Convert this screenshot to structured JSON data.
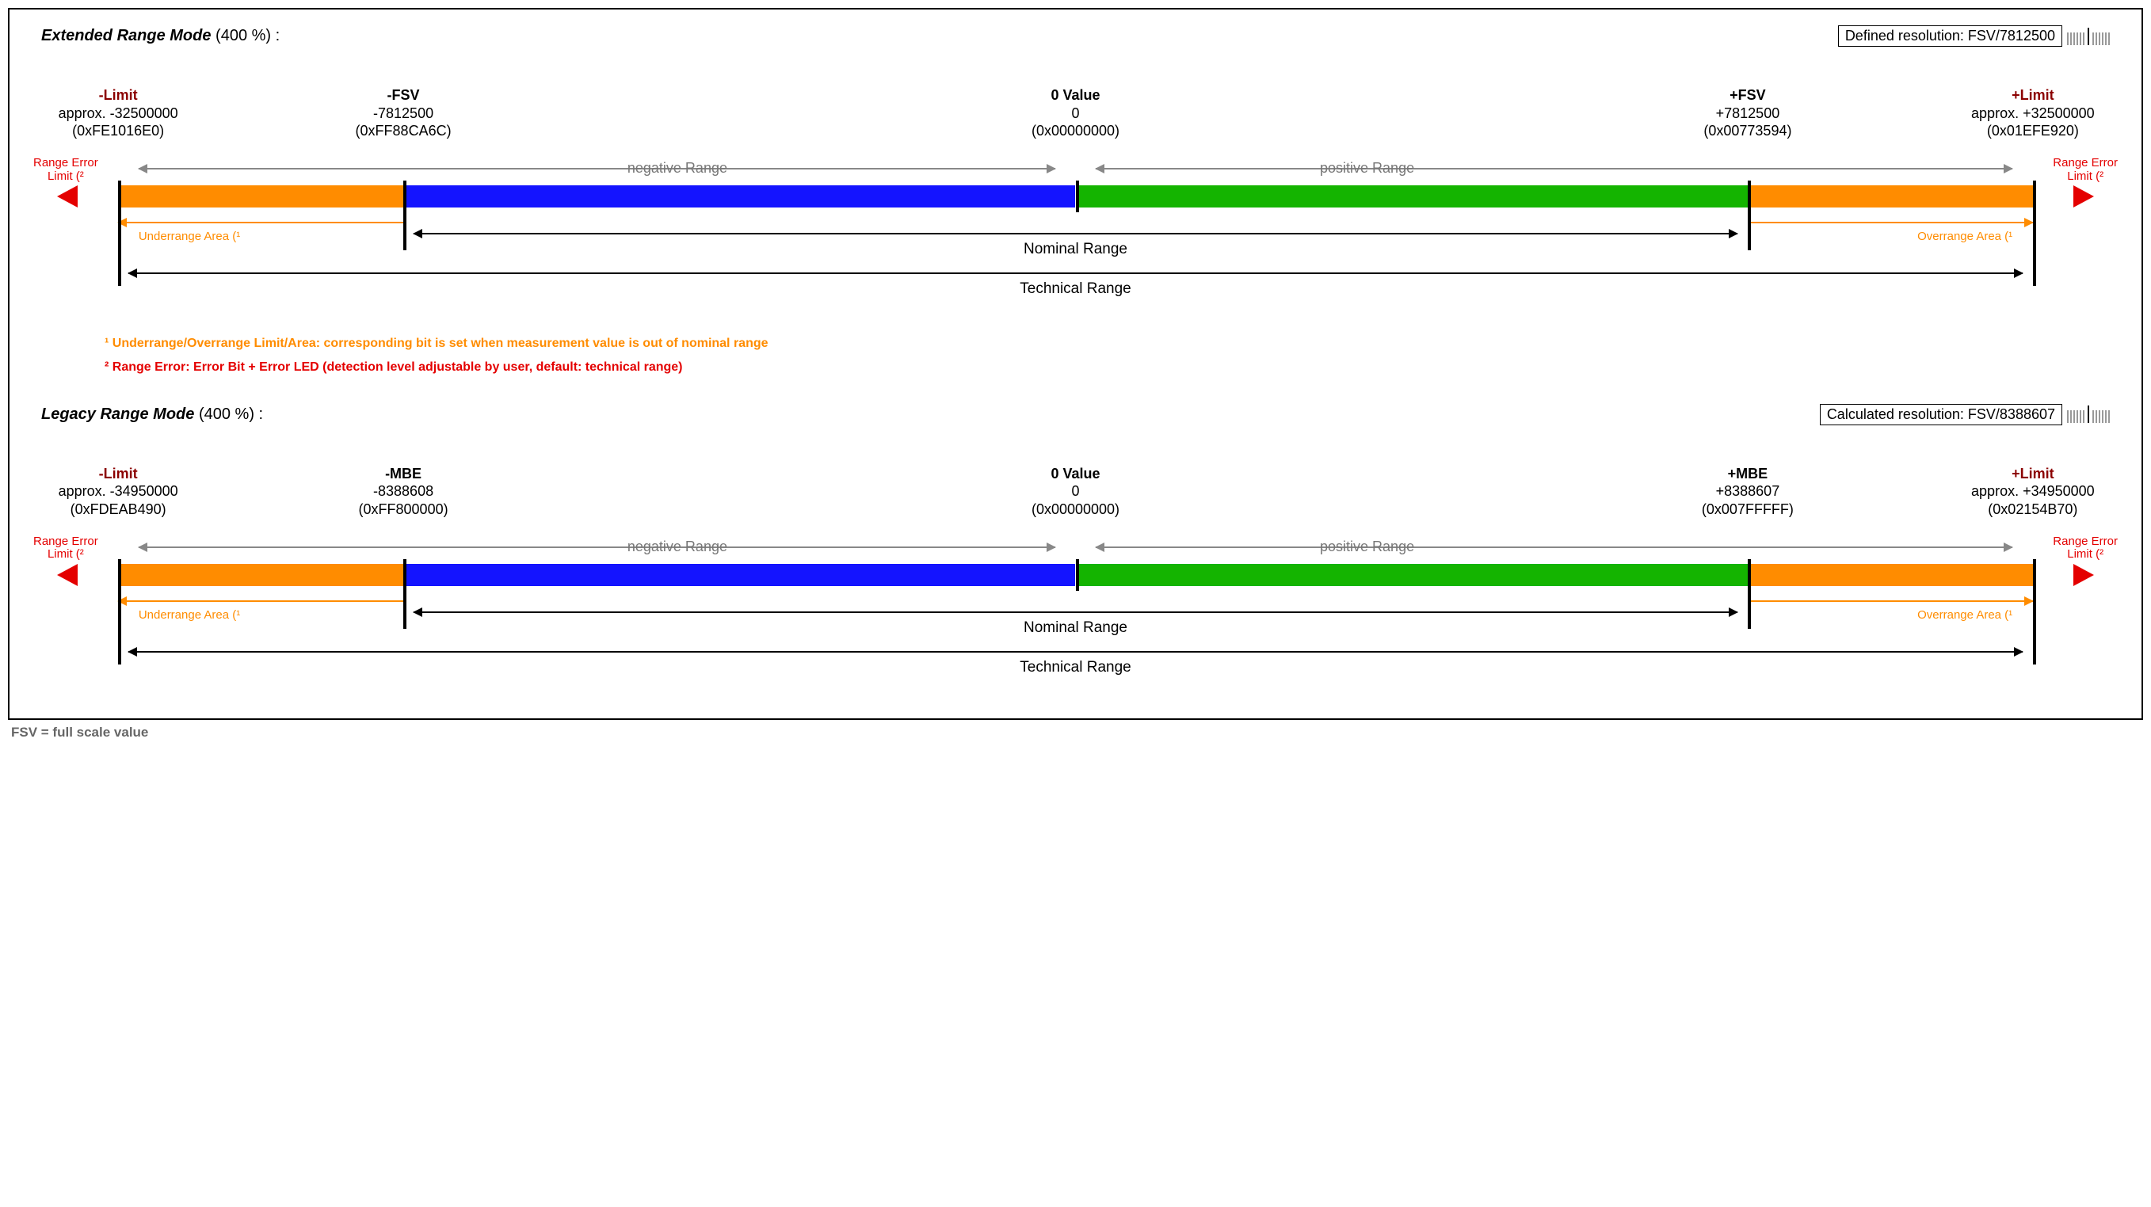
{
  "extended": {
    "title_bold": "Extended Range Mode",
    "title_rest": " (400 %) :",
    "resolution": "Defined resolution: FSV/7812500",
    "points": {
      "neg_limit": {
        "t1": "-Limit",
        "t2": "approx. -32500000",
        "t3": "(0xFE1016E0)"
      },
      "neg_fsv": {
        "t1": "-FSV",
        "t2": "-7812500",
        "t3": "(0xFF88CA6C)"
      },
      "zero": {
        "t1": "0 Value",
        "t2": "0",
        "t3": "(0x00000000)"
      },
      "pos_fsv": {
        "t1": "+FSV",
        "t2": "+7812500",
        "t3": "(0x00773594)"
      },
      "pos_limit": {
        "t1": "+Limit",
        "t2": "approx. +32500000",
        "t3": "(0x01EFE920)"
      }
    }
  },
  "legacy": {
    "title_bold": "Legacy Range Mode",
    "title_rest": " (400 %) :",
    "resolution": "Calculated resolution: FSV/8388607",
    "points": {
      "neg_limit": {
        "t1": "-Limit",
        "t2": "approx. -34950000",
        "t3": "(0xFDEAB490)"
      },
      "neg_mbe": {
        "t1": "-MBE",
        "t2": "-8388608",
        "t3": "(0xFF800000)"
      },
      "zero": {
        "t1": "0 Value",
        "t2": "0",
        "t3": "(0x00000000)"
      },
      "pos_mbe": {
        "t1": "+MBE",
        "t2": "+8388607",
        "t3": "(0x007FFFFF)"
      },
      "pos_limit": {
        "t1": "+Limit",
        "t2": "approx. +34950000",
        "t3": "(0x02154B70)"
      }
    }
  },
  "labels": {
    "range_error": "Range Error\nLimit (²",
    "neg_range": "negative Range",
    "pos_range": "positive Range",
    "nominal": "Nominal Range",
    "technical": "Technical Range",
    "underrange": "Underrange Area (¹",
    "overrange": "Overrange Area (¹"
  },
  "notes": {
    "n1": "¹ Underrange/Overrange Limit/Area: corresponding bit is set when measurement value is out of nominal range",
    "n2": "² Range Error: Error Bit + Error LED (detection level adjustable by user, default: technical range)"
  },
  "footer": "FSV = full scale value"
}
